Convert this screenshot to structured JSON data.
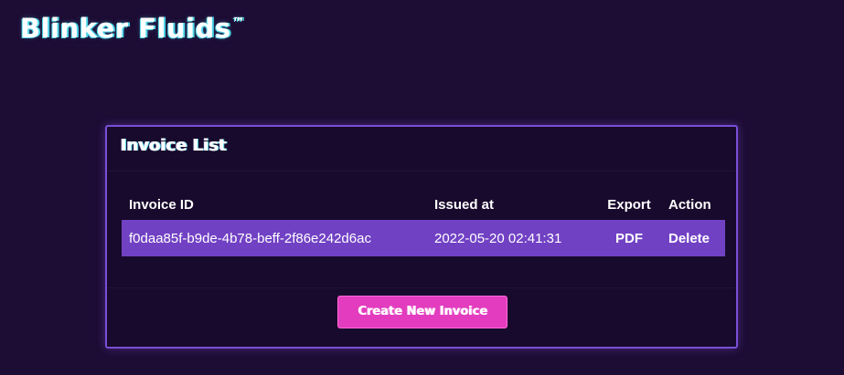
{
  "brand": {
    "name": "Blinker Fluids",
    "trademark": "™"
  },
  "card": {
    "title": "Invoice List"
  },
  "table": {
    "headers": {
      "id": "Invoice ID",
      "issued": "Issued at",
      "export": "Export",
      "action": "Action"
    },
    "rows": [
      {
        "id": "f0daa85f-b9de-4b78-beff-2f86e242d6ac",
        "issued": "2022-05-20 02:41:31",
        "export": "PDF",
        "action": "Delete"
      }
    ]
  },
  "footer": {
    "create_label": "Create New Invoice"
  },
  "colors": {
    "background": "#1d0c34",
    "accent_purple": "#7a4fd6",
    "row_highlight": "#7141c4",
    "button_pink": "#e33cbe",
    "glow_cyan": "#4fd6e8"
  }
}
